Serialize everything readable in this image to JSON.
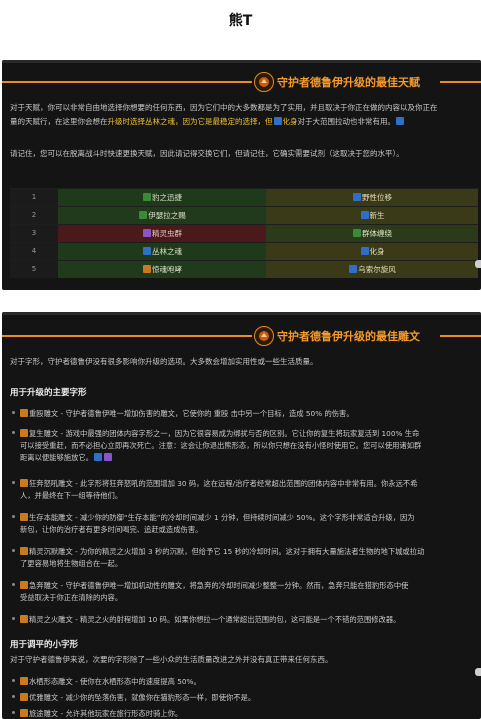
{
  "page_title": "熊T",
  "talents": {
    "header": "守护者德鲁伊升级的最佳天赋",
    "para1_line1": "对于天赋，你可以非常自由地选择你想要的任何东西，因为它们中的大多数都是为了实用，并且取决于你正在做的内容以及你正在",
    "para1_line2_a": "量的天赋行，在这里你会想在",
    "para1_line2_hl1": "升级时选择丛林之魂，因为它是最稳定的选择，但",
    "para1_line2_hl2": "化身",
    "para1_line2_b": "对于大范围拉动也非常有用。",
    "para2": "请记住，您可以在脱离战斗时快速更换天赋，因此请记得交换它们，但请记住，它确实需要试剂（这取决于您的水平）。",
    "rows": [
      {
        "num": "1",
        "a": "豹之迅捷",
        "b": "野性位移"
      },
      {
        "num": "2",
        "a": "伊瑟拉之赐",
        "b": "新生"
      },
      {
        "num": "3",
        "a": "精灵虫群",
        "b": "群体缠绕"
      },
      {
        "num": "4",
        "a": "丛林之魂",
        "b": "化身"
      },
      {
        "num": "5",
        "a": "惊魂咆哮",
        "b": "乌索尔旋风"
      }
    ]
  },
  "glyphs": {
    "header": "守护者德鲁伊升级的最佳雕文",
    "intro": "对于字形，守护者德鲁伊没有很多影响你升级的选项。大多数会增加实用性或一些生活质量。",
    "major_title": "用于升级的主要字形",
    "major": [
      {
        "l1": "重殴雕文 - 守护者德鲁伊唯一增加伤害的雕文，它使你的 重殴 击中另一个目标，造成 50% 的伤害。"
      },
      {
        "l1": "复生雕文 - 游戏中最强的团体内容字形之一，因为它很容易成为绑扰与否的区别。它让你的复生将玩家复活到 100% 生命",
        "l2": "可以接受重赶，而不必担心立即再次死亡。注意：这会让你退出熊形态，所以你只想在没有小怪时使用它。您可以使用诸如群",
        "l3": "距离以便能够施放它。"
      },
      {
        "l1": "狂奔怒吼雕文 - 此字形将狂奔怒吼的范围增加 30 码，这在远程/治疗者经常超出范围的团体内容中非常有用。你永远不希",
        "l2": "人，并最终在下一组等待他们。"
      },
      {
        "l1": "生存本能雕文 - 减少你的防御“生存本能”的冷却时间减少 1 分钟，但持续时间减少 50%。这个字形非常适合升级，因为",
        "l2": "新包，让你的治疗者有更多时间喝完、追赶或造成伤害。"
      },
      {
        "l1": "精灵沉默雕文 - 为你的精灵之火增加 3 秒的沉默，但给予它 15 秒的冷却时间。这对于拥有大量施法者生物的地下城或拉动",
        "l2": "了更容易地将生物组合在一起。"
      },
      {
        "l1": "急奔雕文 - 守护者德鲁伊唯一增加机动性的雕文，将急奔的冷却时间减少整整一分钟。然而，急奔只能在猎豹形态中使",
        "l2": "受益取决于你正在清除的内容。"
      },
      {
        "l1": "精灵之火雕文 - 精灵之火的射程增加 10 码。如果你想拉一个通常超出范围的包，这可能是一个不错的范围修改器。"
      }
    ],
    "minor_title": "用于调平的小字形",
    "minor_intro": "对于守护者德鲁伊来说，次要的字形除了一些小众的生活质量改进之外并没有真正带来任何东西。",
    "minor": [
      {
        "l1": "水栖形态雕文 - 使你在水栖形态中的速度提高 50%。"
      },
      {
        "l1": "优雅雕文 - 减少你的坠落伤害，就像你在猫豹形态一样，即使你不是。"
      },
      {
        "l1": "旅途雕文 - 允许其他玩家在旅行形态时骑上你。"
      }
    ]
  },
  "colors": {
    "accent_orange": "#f08a1a",
    "highlight_yellow": "#f2c230",
    "panel_bg": "#141414"
  }
}
